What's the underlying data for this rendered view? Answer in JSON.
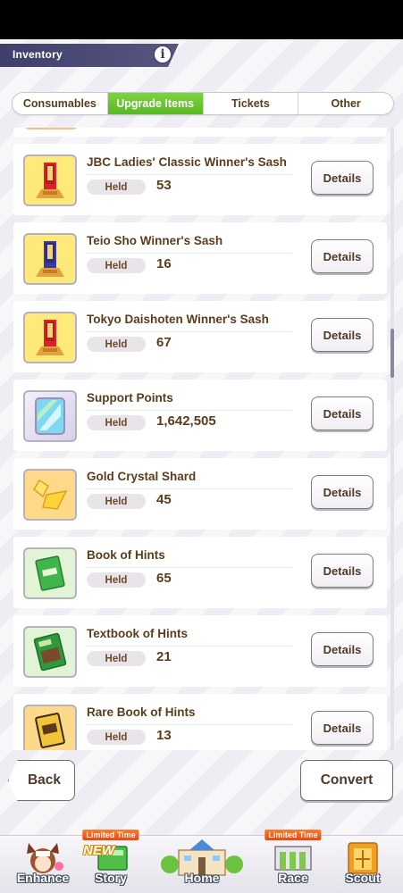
{
  "header": {
    "title": "Inventory",
    "info_icon": "i"
  },
  "tabs": [
    {
      "label": "Consumables",
      "active": false
    },
    {
      "label": "Upgrade Items",
      "active": true
    },
    {
      "label": "Tickets",
      "active": false
    },
    {
      "label": "Other",
      "active": false
    }
  ],
  "held_label": "Held",
  "details_label": "Details",
  "items": [
    {
      "name": "JBC Ladies' Classic Winner's Sash",
      "held": "53",
      "icon": "red-sash-icon"
    },
    {
      "name": "Teio Sho Winner's Sash",
      "held": "16",
      "icon": "purple-sash-icon"
    },
    {
      "name": "Tokyo Daishoten Winner's Sash",
      "held": "67",
      "icon": "red-sash-icon"
    },
    {
      "name": "Support Points",
      "held": "1,642,505",
      "icon": "support-card-icon"
    },
    {
      "name": "Gold Crystal Shard",
      "held": "45",
      "icon": "gold-crystal-icon"
    },
    {
      "name": "Book of Hints",
      "held": "65",
      "icon": "green-book-icon"
    },
    {
      "name": "Textbook of Hints",
      "held": "21",
      "icon": "textbook-icon"
    },
    {
      "name": "Rare Book of Hints",
      "held": "13",
      "icon": "gold-book-icon"
    }
  ],
  "buttons": {
    "back": "Back",
    "convert": "Convert"
  },
  "nav": [
    {
      "label": "Enhance",
      "badge": ""
    },
    {
      "label": "Story",
      "badge": "Limited Time",
      "extra": "NEW"
    },
    {
      "label": "Home",
      "badge": ""
    },
    {
      "label": "Race",
      "badge": "Limited Time"
    },
    {
      "label": "Scout",
      "badge": ""
    }
  ],
  "colors": {
    "active_tab": "#6cc530",
    "header_bg": "#4a4a76",
    "text_brown": "#5b3c1c"
  }
}
